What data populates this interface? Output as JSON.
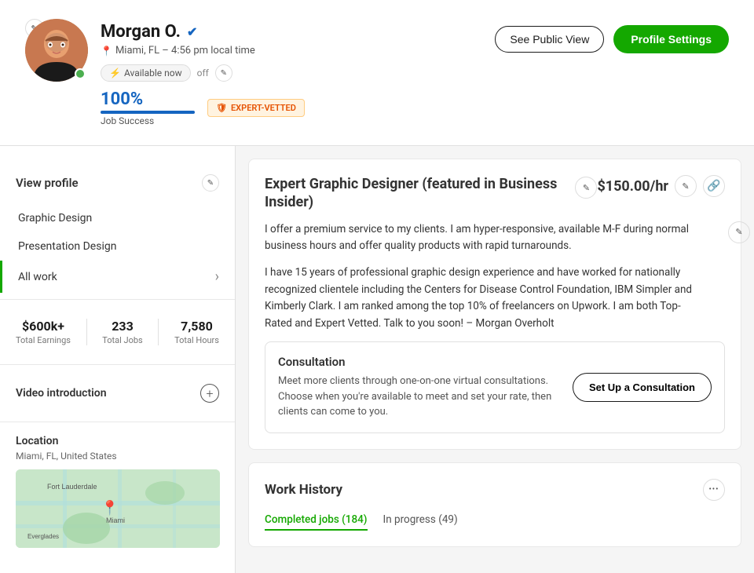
{
  "header": {
    "name": "Morgan O.",
    "location": "Miami, FL – 4:56 pm local time",
    "availability_label": "Available now",
    "availability_state": "off",
    "job_success_pct": "100%",
    "job_success_label": "Job Success",
    "job_success_fill": 100,
    "expert_vetted": "EXPERT-VETTED",
    "see_public_view": "See Public View",
    "profile_settings": "Profile Settings"
  },
  "sidebar": {
    "view_profile_label": "View profile",
    "nav_items": [
      {
        "label": "Graphic Design",
        "active": false
      },
      {
        "label": "Presentation Design",
        "active": false
      },
      {
        "label": "All work",
        "active": true
      }
    ],
    "stats": [
      {
        "value": "$600k+",
        "label": "Total Earnings"
      },
      {
        "value": "233",
        "label": "Total Jobs"
      },
      {
        "value": "7,580",
        "label": "Total Hours"
      }
    ],
    "video_intro_label": "Video introduction",
    "location_title": "Location",
    "location_text": "Miami, FL, United States"
  },
  "bio": {
    "title": "Expert Graphic Designer (featured in Business Insider)",
    "rate": "$150.00/hr",
    "paragraph1": "I offer a premium service to my clients. I am hyper-responsive, available M-F during normal business hours and offer quality products with rapid turnarounds.",
    "paragraph2": "I have 15 years of professional graphic design experience and have worked for nationally recognized clientele including the Centers for Disease Control Foundation, IBM Simpler and Kimberly Clark. I am ranked among the top 10% of freelancers on Upwork. I am both Top-Rated and Expert Vetted. Talk to you soon! – Morgan Overholt"
  },
  "consultation": {
    "title": "Consultation",
    "description": "Meet more clients through one-on-one virtual consultations. Choose when you're available to meet and set your rate, then clients can come to you.",
    "button_label": "Set Up a Consultation"
  },
  "work_history": {
    "title": "Work History",
    "tabs": [
      {
        "label": "Completed jobs (184)",
        "active": true
      },
      {
        "label": "In progress (49)",
        "active": false
      }
    ]
  },
  "icons": {
    "edit": "✎",
    "location_pin": "📍",
    "lightning": "⚡",
    "verified": "✓",
    "chevron_right": "›",
    "plus": "+",
    "link": "🔗",
    "more": "•••",
    "shield": "🛡"
  }
}
